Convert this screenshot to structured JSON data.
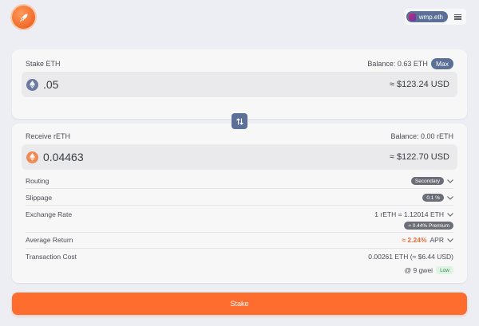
{
  "header": {
    "wallet_name": "wmp.eth"
  },
  "stake": {
    "label": "Stake ETH",
    "balance": "Balance: 0.63 ETH",
    "max_label": "Max",
    "amount": ".05",
    "usd": "≈ $123.24 USD"
  },
  "receive": {
    "label": "Receive rETH",
    "balance": "Balance: 0.00 rETH",
    "amount": "0.04463",
    "usd": "≈ $122.70 USD"
  },
  "details": {
    "routing": {
      "label": "Routing",
      "value": "Secondary"
    },
    "slippage": {
      "label": "Slippage",
      "value": "0.1 %"
    },
    "exchange_rate": {
      "label": "Exchange Rate",
      "value": "1 rETH = 1.12014 ETH",
      "premium": "≈ 0.44% Premium"
    },
    "average_return": {
      "label": "Average Return",
      "value": "≈ 2.24%",
      "unit": "APR"
    },
    "transaction_cost": {
      "label": "Transaction Cost",
      "value": "0.00261 ETH (≈ $6.44 USD)",
      "gas": "@ 9 gwei",
      "gas_level": "Low"
    }
  },
  "actions": {
    "stake_label": "Stake"
  },
  "colors": {
    "accent": "#ff6d2e",
    "primary_blue": "#5b6f97",
    "background": "#eceef3"
  }
}
